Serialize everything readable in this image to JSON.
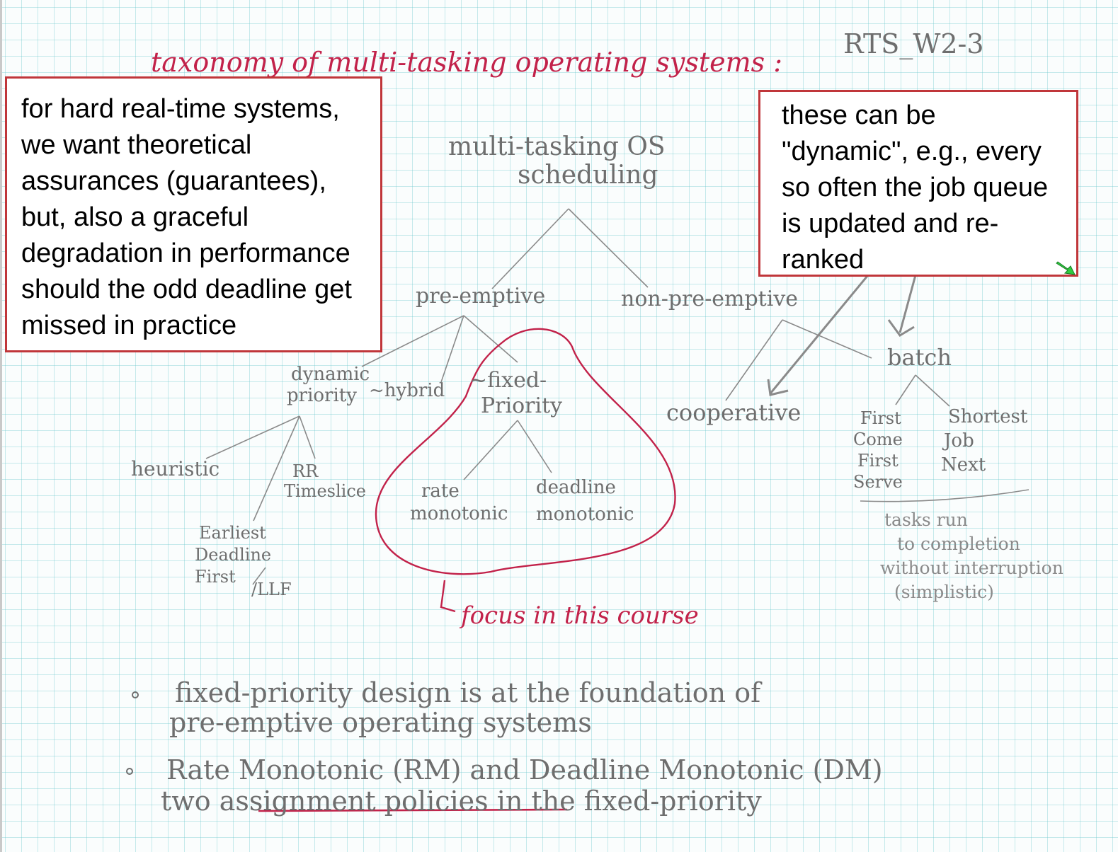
{
  "header": {
    "title": "taxonomy of multi-tasking operating systems :",
    "page_code": "RTS_W2-3"
  },
  "tree": {
    "root": [
      "multi-tasking OS",
      "scheduling"
    ],
    "preemptive": "pre-emptive",
    "non_preemptive": "non-pre-emptive",
    "dynamic": [
      "dynamic",
      "priority"
    ],
    "hybrid": "~hybrid",
    "fixed": [
      "~fixed-",
      "Priority"
    ],
    "heuristic": "heuristic",
    "rr": [
      "RR",
      "Timeslice"
    ],
    "edf": [
      "Earliest",
      "Deadline",
      "First"
    ],
    "llf": "/LLF",
    "rate": [
      "rate",
      "monotonic"
    ],
    "deadline": [
      "deadline",
      "monotonic"
    ],
    "cooperative": "cooperative",
    "batch": "batch",
    "fcfs": [
      "First",
      "Come",
      "First",
      "Serve"
    ],
    "sjn": [
      "Shortest",
      "Job",
      "Next"
    ],
    "batch_note": [
      "tasks run",
      "to completion",
      "without interruption",
      "(simplistic)"
    ],
    "focus": "focus in this course"
  },
  "notes": {
    "left": "for hard real-time systems, we want theoretical assurances (guarantees), but, also a graceful degradation in performance should the odd deadline get missed in practice",
    "right": "these can be \"dynamic\", e.g., every so often the job queue is updated and re-ranked"
  },
  "bullets": [
    [
      "fixed-priority design is at the foundation of",
      "pre-emptive operating systems"
    ],
    [
      "Rate Monotonic (RM) and Deadline Monotonic (DM)",
      "two assignment policies in the fixed-priority"
    ]
  ],
  "colors": {
    "ink": "#6e6e6e",
    "accent": "#c2224a",
    "note_border": "#c0363a",
    "grid": "#6ec8cd"
  },
  "icons": [
    "pin-arrow-icon"
  ]
}
